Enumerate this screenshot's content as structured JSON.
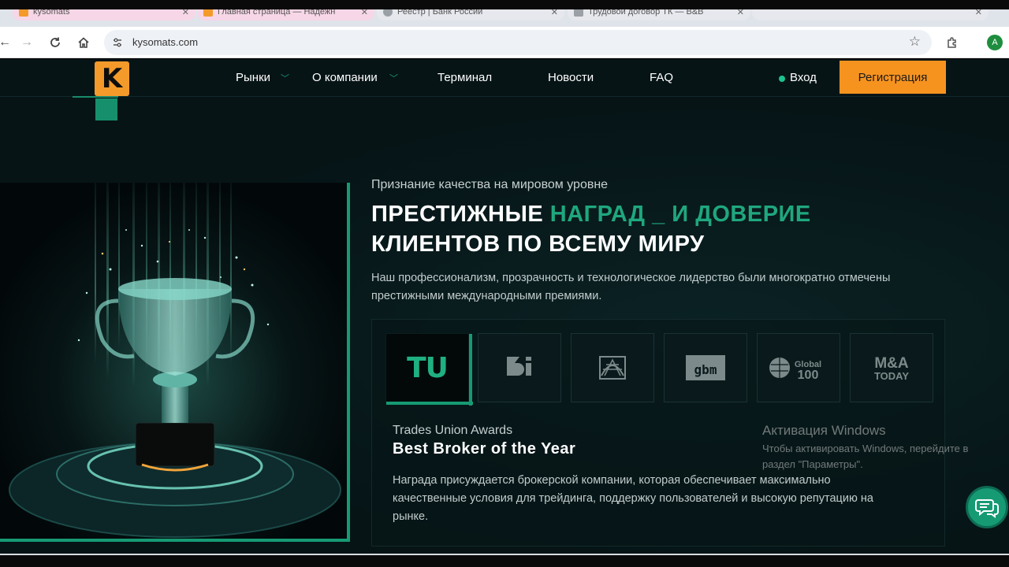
{
  "browser": {
    "tabs": [
      {
        "label": "kysomats",
        "fav_color": "#f39a2b"
      },
      {
        "label": "Главная страница — Надежн",
        "fav_color": "#f39a2b"
      },
      {
        "label": "Реестр | Банк России",
        "fav_color": "#9aa0a6"
      },
      {
        "label": "Трудовой договор ТК — B&B",
        "fav_color": "#9aa0a6"
      },
      {
        "label": "",
        "fav_color": "#9aa0a6"
      }
    ],
    "url": "kysomats.com",
    "profile_initial": "A"
  },
  "header": {
    "logo_letter": "K",
    "menu": [
      "Рынки",
      "О компании",
      "Терминал",
      "Новости",
      "FAQ"
    ],
    "login_label": "Вход",
    "register_label": "Регистрация"
  },
  "hero": {
    "subtitle": "Признание качества на мировом уровне",
    "headline_part1": "ПРЕСТИЖНЫЕ ",
    "headline_accent": "НАГРАД _ И ДОВЕРИЕ",
    "headline_line2": "КЛИЕНТОВ ПО ВСЕМУ МИРУ",
    "description": "Наш профессионализм, прозрачность и технологическое лидерство были многократно отмечены престижными международными премиями."
  },
  "awards": {
    "tiles": [
      {
        "label": "TU"
      },
      {
        "label": "BI"
      },
      {
        "label": ""
      },
      {
        "label": "gbm"
      },
      {
        "label": "Global 100"
      },
      {
        "label": "M&A TODAY"
      }
    ],
    "selected_name": "Trades Union Awards",
    "selected_title": "Best Broker of the Year",
    "selected_text": "Награда присуждается брокерской компании, которая обеспечивает максимально качественные условия для трейдинга, поддержку пользователей и высокую репутацию на рынке."
  },
  "watermark": {
    "line1": "Активация Windows",
    "line2": "Чтобы активировать Windows, перейдите в раздел \"Параметры\"."
  },
  "colors": {
    "accent": "#169a74",
    "brand_orange": "#f6931f",
    "background": "#061416"
  }
}
